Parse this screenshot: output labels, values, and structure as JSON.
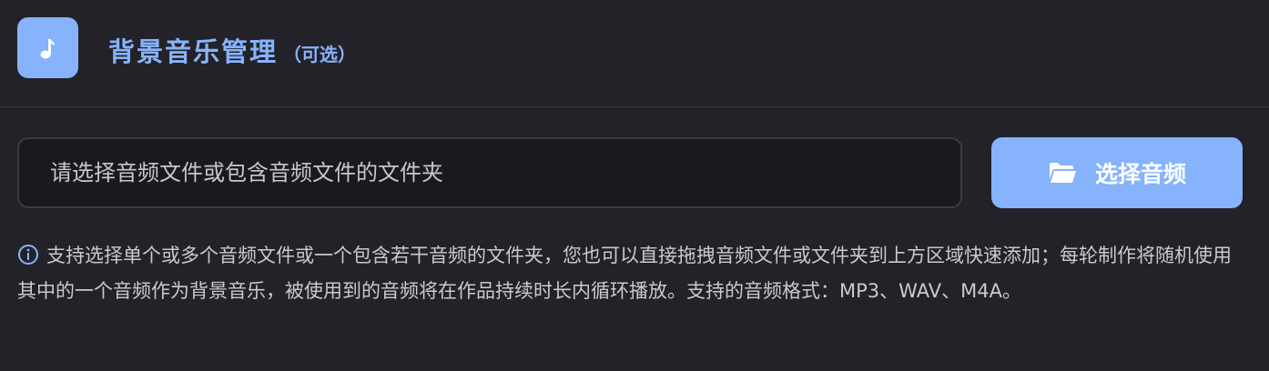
{
  "header": {
    "title": "背景音乐管理",
    "subtitle": "（可选）",
    "icon": "music-note-icon"
  },
  "input": {
    "placeholder": "请选择音频文件或包含音频文件的文件夹",
    "value": ""
  },
  "choose_button": {
    "label": "选择音频",
    "icon": "folder-icon"
  },
  "help": {
    "icon": "info-icon",
    "text": "支持选择单个或多个音频文件或一个包含若干音频的文件夹，您也可以直接拖拽音频文件或文件夹到上方区域快速添加；每轮制作将随机使用其中的一个音频作为背景音乐，被使用到的音频将在作品持续时长内循环播放。支持的音频格式：MP3、WAV、M4A。"
  },
  "colors": {
    "accent": "#86b3fb",
    "background": "#232228",
    "input_background": "#1a1a1e",
    "text": "#c9c9cf"
  }
}
